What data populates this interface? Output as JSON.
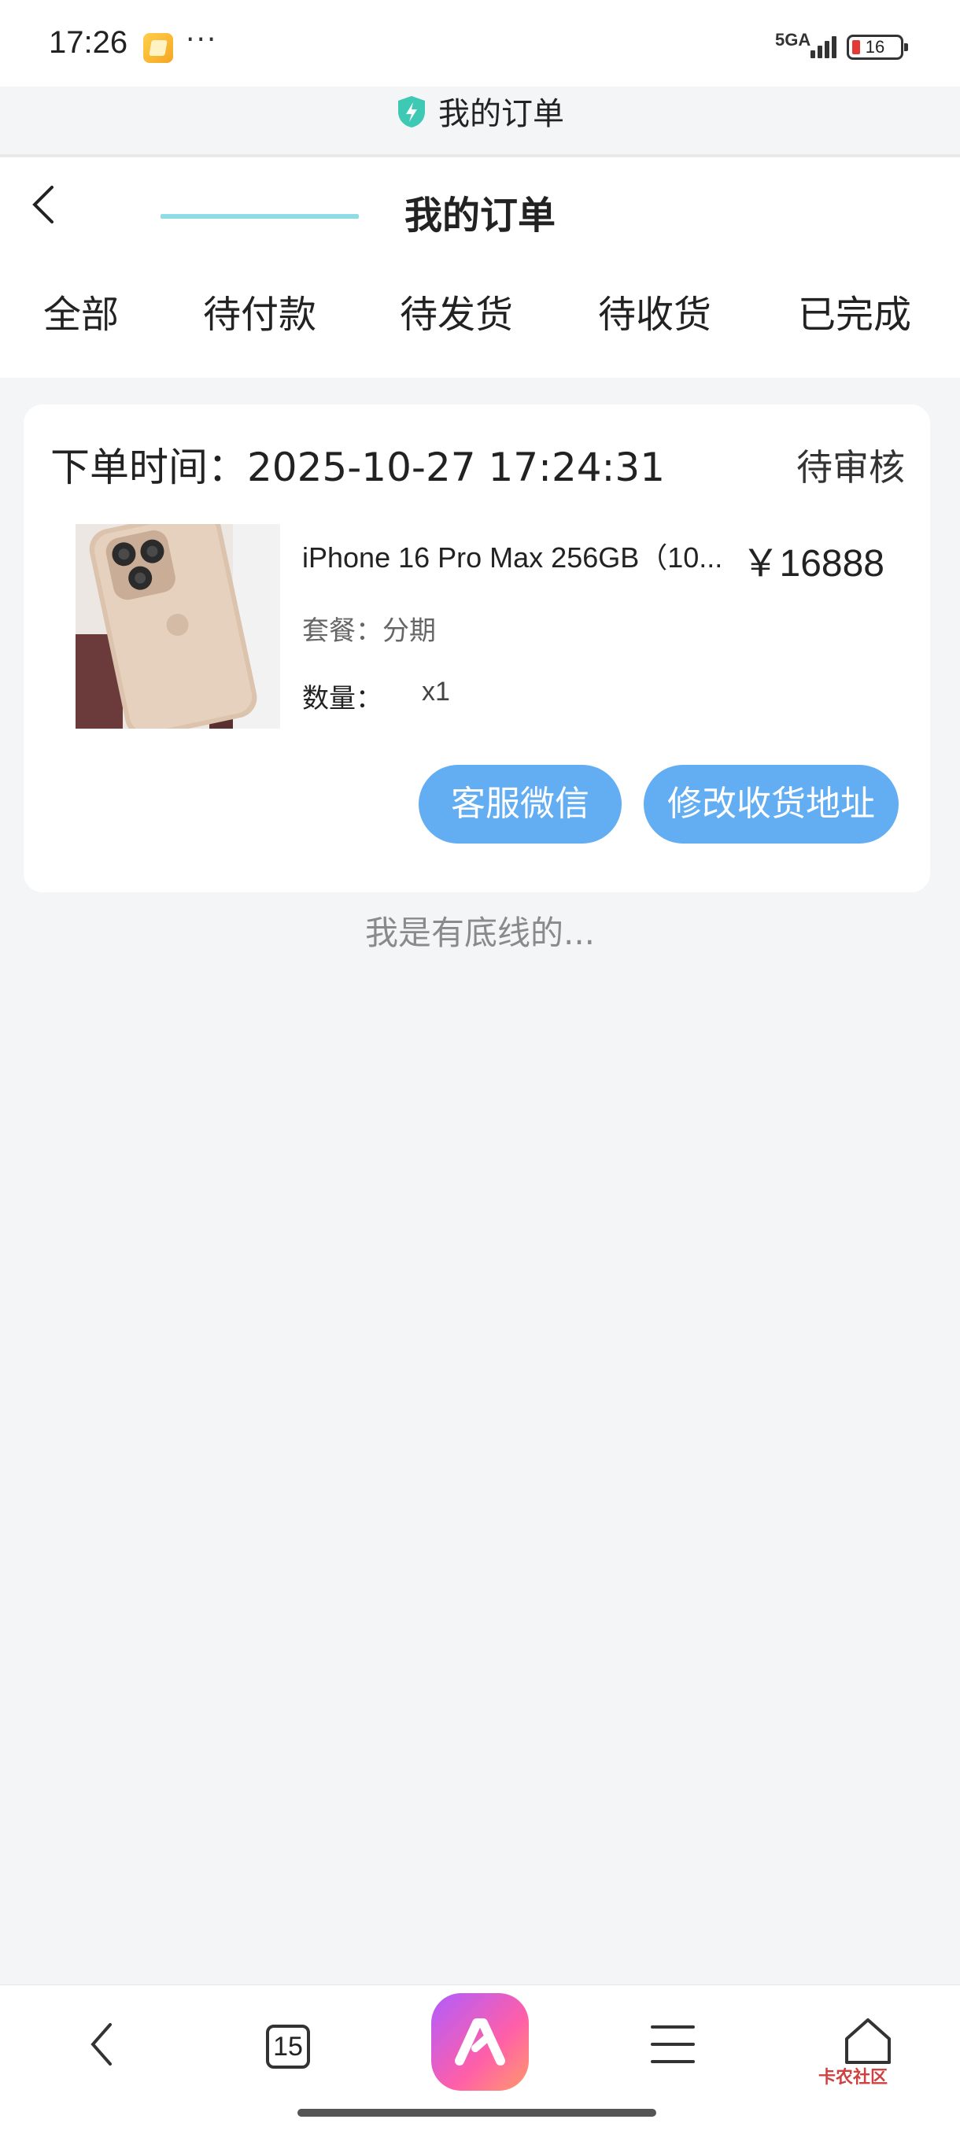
{
  "status_bar": {
    "time": "17:26",
    "dots": "···",
    "network": "5GA",
    "battery": "16",
    "battery_color": "#e53935"
  },
  "browser": {
    "title": "我的订单",
    "shield_color": "#3ec9b5"
  },
  "header": {
    "title": "我的订单",
    "back_icon": "chevron-left-icon"
  },
  "tabs": [
    {
      "label": "全部"
    },
    {
      "label": "待付款"
    },
    {
      "label": "待发货"
    },
    {
      "label": "待收货"
    },
    {
      "label": "已完成"
    }
  ],
  "active_tab_index": 1,
  "accent_color": "#8fdbe6",
  "order": {
    "time_label": "下单时间：2025-10-27 17:24:31",
    "status": "待审核",
    "product_name": "iPhone 16 Pro Max 256GB（10...",
    "price": "￥16888",
    "package": "套餐：分期",
    "quantity_label": "数量：",
    "quantity_value": "x1",
    "buttons": {
      "customer_service": "客服微信",
      "edit_address": "修改收货地址"
    },
    "button_color": "#63aef2"
  },
  "footer_text": "我是有底线的...",
  "bottom_nav": {
    "tab_count": "15",
    "watermark": "卡农社区"
  }
}
